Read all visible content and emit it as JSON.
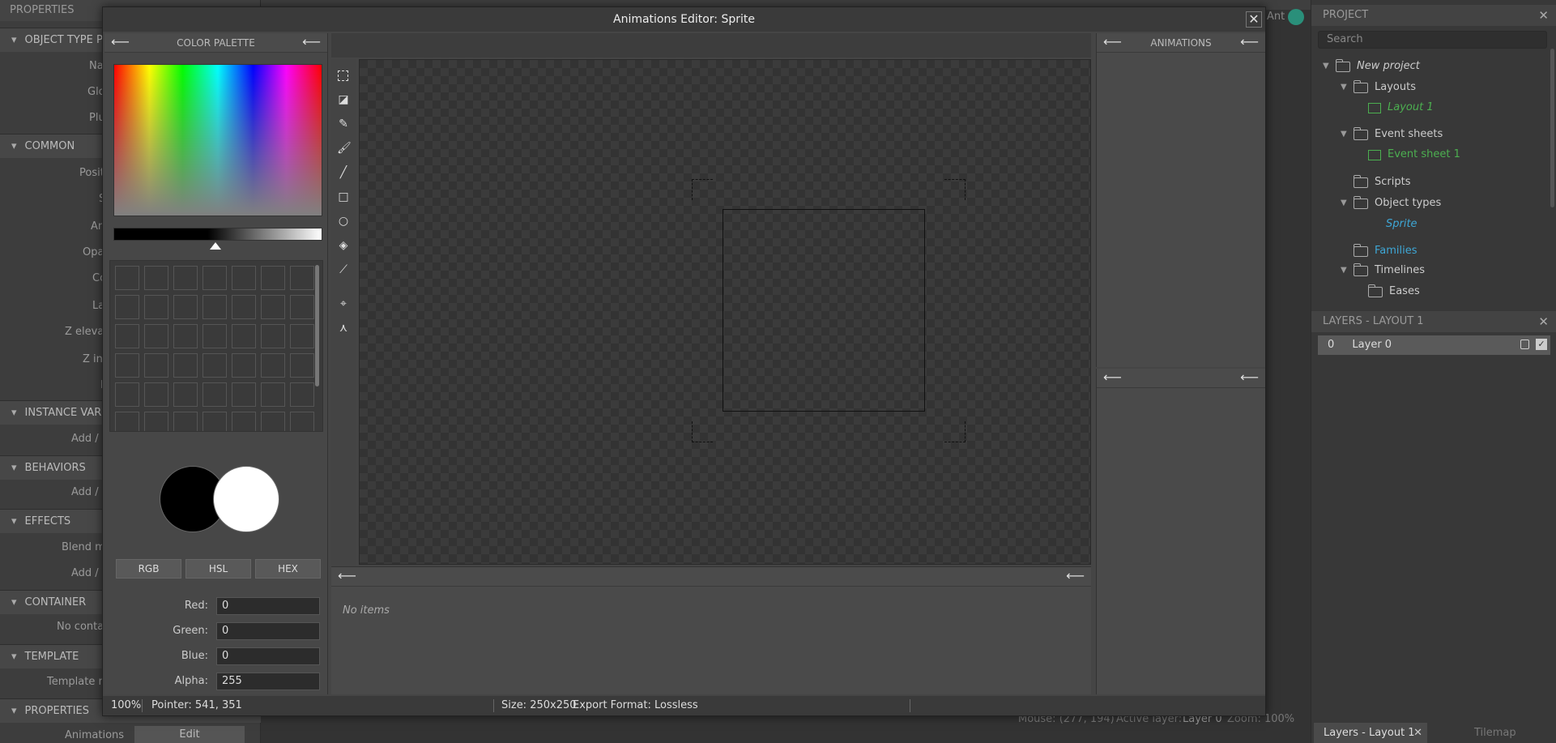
{
  "background": {
    "left_panel": {
      "title": "PROPERTIES",
      "sections": [
        "OBJECT TYPE PR",
        "COMMON",
        "INSTANCE VARIA",
        "BEHAVIORS",
        "EFFECTS",
        "CONTAINER",
        "TEMPLATE",
        "PROPERTIES"
      ],
      "props": [
        "Na",
        "Glo",
        "Plu",
        "Posit",
        "S",
        "An",
        "Opa",
        "Co",
        "La",
        "Z elevat",
        "Z in",
        "I",
        "Add / c",
        "Add / c",
        "Blend mo",
        "Add / c",
        "No conta",
        "Template ma",
        "Animations"
      ],
      "edit_label": "Edit"
    },
    "center": {
      "top_right_text": "Ant",
      "status_mouse": "Mouse: (277, 194)",
      "status_layer_label": "Active layer:",
      "status_layer_value": "Layer 0",
      "status_zoom": "Zoom: 100%"
    },
    "project": {
      "title": "PROJECT",
      "search_placeholder": "Search",
      "tree": {
        "root": "New project",
        "layouts": "Layouts",
        "layout1": "Layout 1",
        "event_sheets": "Event sheets",
        "event_sheet1": "Event sheet 1",
        "scripts": "Scripts",
        "object_types": "Object types",
        "sprite": "Sprite",
        "families": "Families",
        "timelines": "Timelines",
        "eases": "Eases"
      }
    },
    "layers": {
      "title": "LAYERS - LAYOUT 1",
      "row_index": "0",
      "row_name": "Layer 0"
    },
    "bottom_tabs": {
      "active": "Layers - Layout 1",
      "inactive": "Tilemap"
    }
  },
  "dialog": {
    "title": "Animations Editor: Sprite",
    "palette": {
      "title": "COLOR PALETTE",
      "modes": [
        "RGB",
        "HSL",
        "HEX"
      ],
      "fields": {
        "red_label": "Red:",
        "red_value": "0",
        "green_label": "Green:",
        "green_value": "0",
        "blue_label": "Blue:",
        "blue_value": "0",
        "alpha_label": "Alpha:",
        "alpha_value": "255"
      },
      "primary_color": "#000000",
      "secondary_color": "#ffffff"
    },
    "animations_title": "ANIMATIONS",
    "frames_empty": "No items",
    "status": {
      "zoom": "100%",
      "pointer": "Pointer: 541, 351",
      "size": "Size: 250x250",
      "export": "Export Format: Lossless"
    }
  },
  "icons": {
    "back": "arrow-left-icon",
    "close": "close-icon",
    "folder": "folder-icon"
  },
  "colors": {
    "tree_link_green": "#4caf50",
    "tree_link_blue": "#3ea7d6"
  }
}
